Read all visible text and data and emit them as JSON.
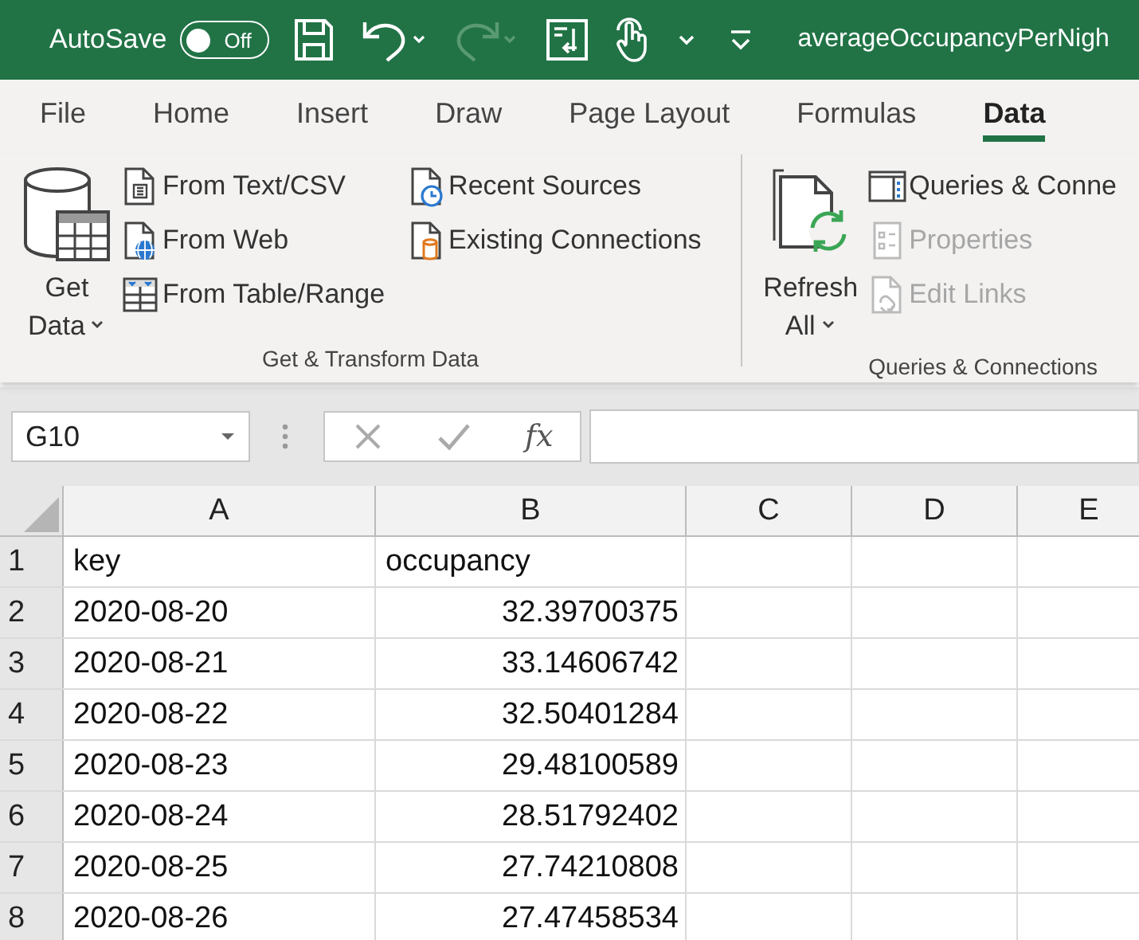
{
  "title_bar": {
    "autosave": {
      "label": "AutoSave",
      "on": false,
      "state_text": "Off"
    },
    "title": "averageOccupancyPerNigh"
  },
  "tabs": [
    {
      "label": "File",
      "selected": false
    },
    {
      "label": "Home",
      "selected": false
    },
    {
      "label": "Insert",
      "selected": false
    },
    {
      "label": "Draw",
      "selected": false
    },
    {
      "label": "Page Layout",
      "selected": false
    },
    {
      "label": "Formulas",
      "selected": false
    },
    {
      "label": "Data",
      "selected": true
    }
  ],
  "ribbon_groups": [
    {
      "label": "Get & Transform Data",
      "large": {
        "kind": "database",
        "lines": [
          "Get",
          "Data"
        ]
      },
      "columns": [
        [
          {
            "label": "From Text/CSV",
            "kind": "text-file",
            "disabled": false
          },
          {
            "label": "From Web",
            "kind": "web",
            "disabled": false
          },
          {
            "label": "From Table/Range",
            "kind": "table",
            "disabled": false
          }
        ],
        [
          {
            "label": "Recent Sources",
            "kind": "recent",
            "disabled": false
          },
          {
            "label": "Existing Connections",
            "kind": "connections",
            "disabled": false
          }
        ]
      ]
    },
    {
      "label": "Queries & Connections",
      "large": {
        "kind": "refresh",
        "lines": [
          "Refresh",
          "All"
        ]
      },
      "columns": [
        [
          {
            "label": "Queries & Conne",
            "kind": "pane",
            "disabled": false
          },
          {
            "label": "Properties",
            "kind": "properties",
            "disabled": true
          },
          {
            "label": "Edit Links",
            "kind": "links",
            "disabled": true
          }
        ]
      ]
    }
  ],
  "name_box": "G10",
  "formula_bar": {
    "function_label": "fx"
  },
  "columns": [
    "A",
    "B",
    "C",
    "D",
    "E"
  ],
  "rows": [
    {
      "number": "1",
      "cells": [
        {
          "text": "key",
          "kind": "text"
        },
        {
          "text": "occupancy",
          "kind": "text"
        }
      ]
    },
    {
      "number": "2",
      "cells": [
        {
          "text": "2020-08-20",
          "kind": "text"
        },
        {
          "text": "32.39700375",
          "kind": "number"
        }
      ]
    },
    {
      "number": "3",
      "cells": [
        {
          "text": "2020-08-21",
          "kind": "text"
        },
        {
          "text": "33.14606742",
          "kind": "number"
        }
      ]
    },
    {
      "number": "4",
      "cells": [
        {
          "text": "2020-08-22",
          "kind": "text"
        },
        {
          "text": "32.50401284",
          "kind": "number"
        }
      ]
    },
    {
      "number": "5",
      "cells": [
        {
          "text": "2020-08-23",
          "kind": "text"
        },
        {
          "text": "29.48100589",
          "kind": "number"
        }
      ]
    },
    {
      "number": "6",
      "cells": [
        {
          "text": "2020-08-24",
          "kind": "text"
        },
        {
          "text": "28.51792402",
          "kind": "number"
        }
      ]
    },
    {
      "number": "7",
      "cells": [
        {
          "text": "2020-08-25",
          "kind": "text"
        },
        {
          "text": "27.74210808",
          "kind": "number"
        }
      ]
    },
    {
      "number": "8",
      "cells": [
        {
          "text": "2020-08-26",
          "kind": "text"
        },
        {
          "text": "27.47458534",
          "kind": "number"
        }
      ]
    }
  ]
}
